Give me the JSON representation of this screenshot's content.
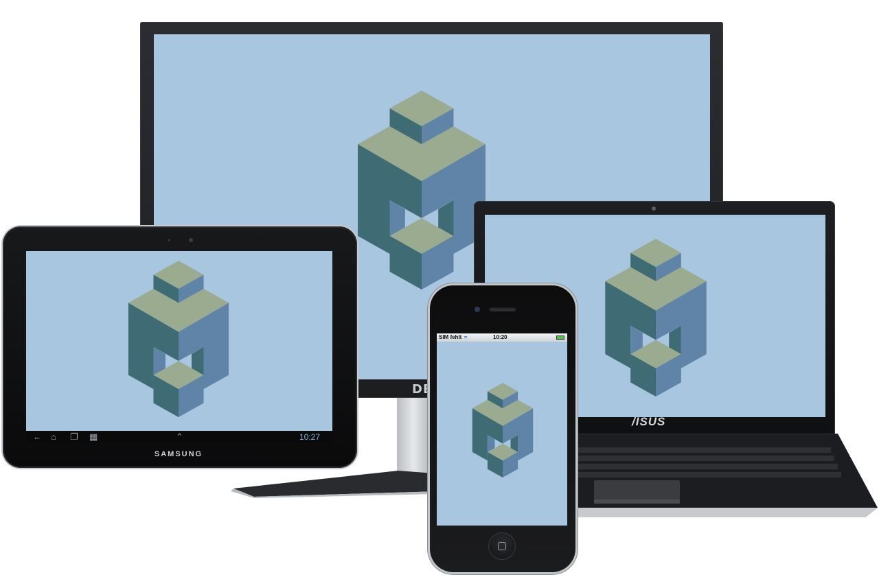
{
  "colors": {
    "screen_bg": "#a9c6e0",
    "logo_top": "#9aab90",
    "logo_left": "#3f6b74",
    "logo_right": "#5f84a8"
  },
  "monitor": {
    "brand": "DELL"
  },
  "laptop": {
    "brand": "/ISUS"
  },
  "tablet": {
    "brand": "SAMSUNG",
    "clock": "10:27",
    "nav_icons": [
      "back-icon",
      "home-icon",
      "recent-apps-icon",
      "screenshot-icon"
    ]
  },
  "phone": {
    "carrier": "SIM fehlt",
    "time": "10:20"
  },
  "logo": {
    "icon": "isometric-cube-logo"
  }
}
